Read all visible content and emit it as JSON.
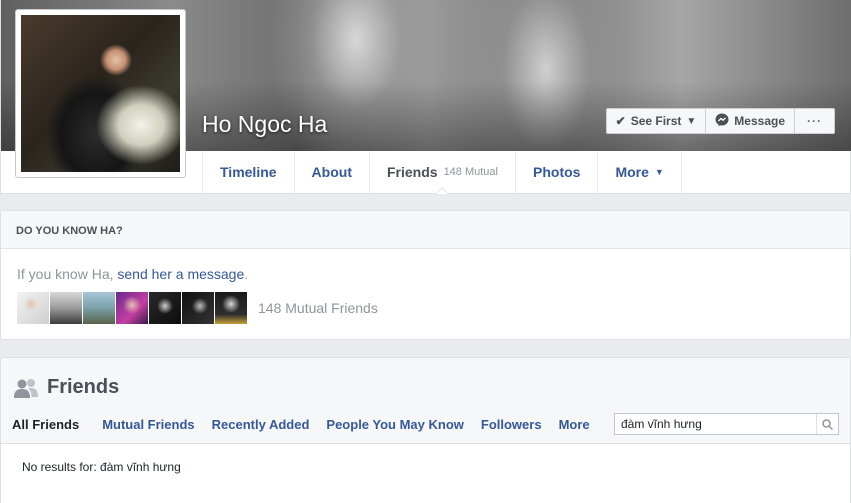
{
  "profile": {
    "name": "Ho Ngoc Ha"
  },
  "cover_actions": {
    "see_first": "See First",
    "message": "Message",
    "more": "···"
  },
  "tabs": [
    {
      "label": "Timeline"
    },
    {
      "label": "About"
    },
    {
      "label": "Friends",
      "sub": "148 Mutual"
    },
    {
      "label": "Photos"
    },
    {
      "label": "More"
    }
  ],
  "know": {
    "heading": "DO YOU KNOW HA?",
    "prefix": "If you know Ha,",
    "link": "send her a message",
    "suffix": ".",
    "mutual_count": "148 Mutual Friends"
  },
  "friends": {
    "title": "Friends",
    "tabs": [
      "All Friends",
      "Mutual Friends",
      "Recently Added",
      "People You May Know",
      "Followers",
      "More"
    ],
    "search_value": "đàm vĩnh hưng",
    "no_results": "No results for: đàm vĩnh hưng"
  },
  "colors": {
    "link": "#365899",
    "muted": "#90949c",
    "text": "#4b4f56"
  }
}
